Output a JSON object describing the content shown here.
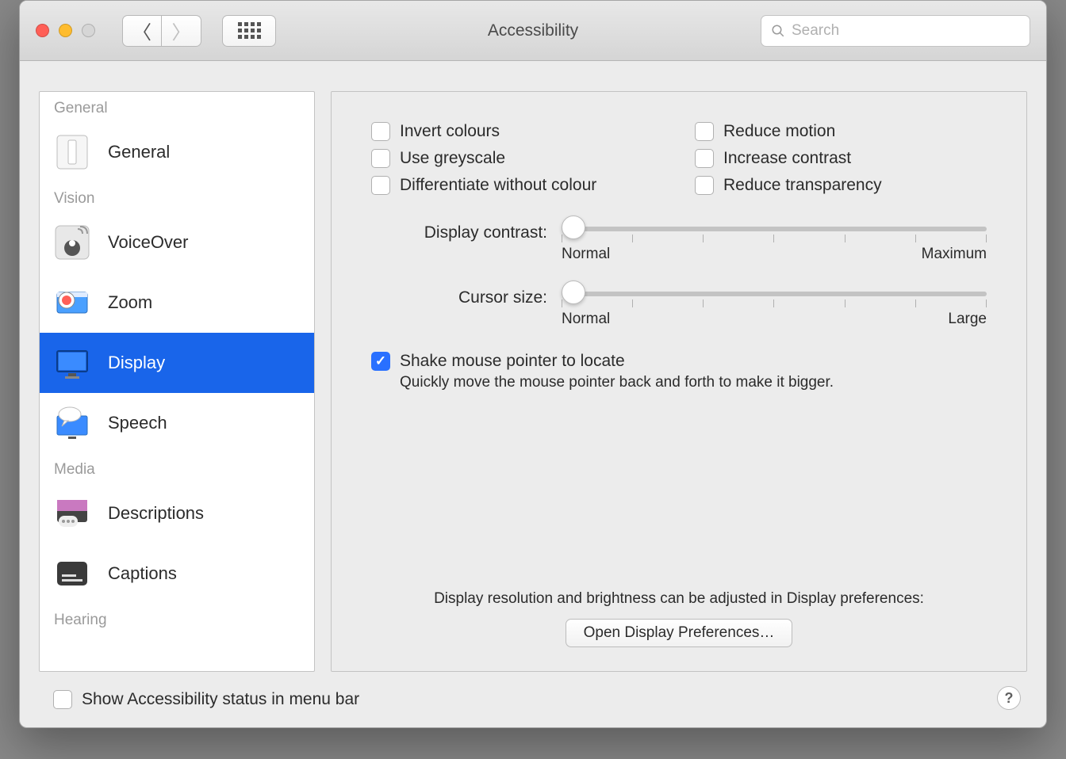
{
  "window": {
    "title": "Accessibility"
  },
  "search": {
    "placeholder": "Search"
  },
  "sidebar": {
    "sections": [
      {
        "header": "General",
        "items": [
          {
            "label": "General",
            "icon": "general"
          }
        ]
      },
      {
        "header": "Vision",
        "items": [
          {
            "label": "VoiceOver",
            "icon": "voiceover"
          },
          {
            "label": "Zoom",
            "icon": "zoom"
          },
          {
            "label": "Display",
            "icon": "display",
            "selected": true
          },
          {
            "label": "Speech",
            "icon": "speech"
          }
        ]
      },
      {
        "header": "Media",
        "items": [
          {
            "label": "Descriptions",
            "icon": "descriptions"
          },
          {
            "label": "Captions",
            "icon": "captions"
          }
        ]
      },
      {
        "header": "Hearing",
        "items": []
      }
    ]
  },
  "checks": {
    "invert": {
      "label": "Invert colours",
      "checked": false
    },
    "greyscale": {
      "label": "Use greyscale",
      "checked": false
    },
    "diff": {
      "label": "Differentiate without colour",
      "checked": false
    },
    "motion": {
      "label": "Reduce motion",
      "checked": false
    },
    "contrast": {
      "label": "Increase contrast",
      "checked": false
    },
    "transparency": {
      "label": "Reduce transparency",
      "checked": false
    }
  },
  "sliders": {
    "contrast": {
      "label": "Display contrast:",
      "min": "Normal",
      "max": "Maximum"
    },
    "cursor": {
      "label": "Cursor size:",
      "min": "Normal",
      "max": "Large"
    }
  },
  "shake": {
    "label": "Shake mouse pointer to locate",
    "checked": true,
    "desc": "Quickly move the mouse pointer back and forth to make it bigger."
  },
  "footer": {
    "text": "Display resolution and brightness can be adjusted in Display preferences:",
    "button": "Open Display Preferences…"
  },
  "bottom": {
    "menubar": "Show Accessibility status in menu bar"
  }
}
